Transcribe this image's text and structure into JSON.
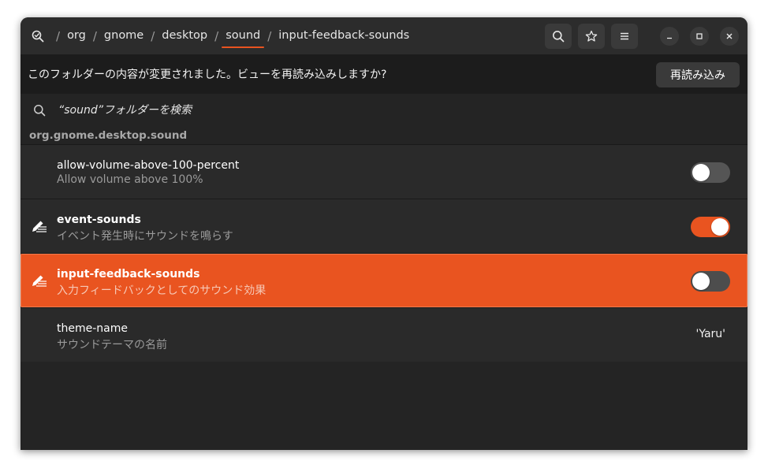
{
  "breadcrumbs": {
    "items": [
      {
        "label": "org"
      },
      {
        "label": "gnome"
      },
      {
        "label": "desktop"
      },
      {
        "label": "sound"
      },
      {
        "label": "input-feedback-sounds"
      }
    ],
    "separator": "/",
    "active_index": 3
  },
  "header_buttons": [
    "search-icon",
    "star-icon",
    "menu-icon"
  ],
  "window_controls": [
    "minimize",
    "maximize",
    "close"
  ],
  "infobar": {
    "message": "このフォルダーの内容が変更されました。ビューを再読み込みしますか?",
    "reload_label": "再読み込み"
  },
  "search": {
    "placeholder": "“sound”フォルダーを検索"
  },
  "section": {
    "title": "org.gnome.desktop.sound"
  },
  "rows": [
    {
      "name": "allow-volume-above-100-percent",
      "description": "Allow volume above 100%",
      "type": "toggle",
      "on": false,
      "modified": false,
      "selected": false
    },
    {
      "name": "event-sounds",
      "description": "イベント発生時にサウンドを鳴らす",
      "type": "toggle",
      "on": true,
      "modified": true,
      "selected": false
    },
    {
      "name": "input-feedback-sounds",
      "description": "入力フィードバックとしてのサウンド効果",
      "type": "toggle",
      "on": false,
      "modified": true,
      "selected": true
    },
    {
      "name": "theme-name",
      "description": "サウンドテーマの名前",
      "type": "value",
      "value": "'Yaru'",
      "modified": false,
      "selected": false
    }
  ],
  "colors": {
    "accent": "#e95420",
    "background": "#242424",
    "header": "#2c2c2c",
    "infobar": "#1c1c1c"
  }
}
